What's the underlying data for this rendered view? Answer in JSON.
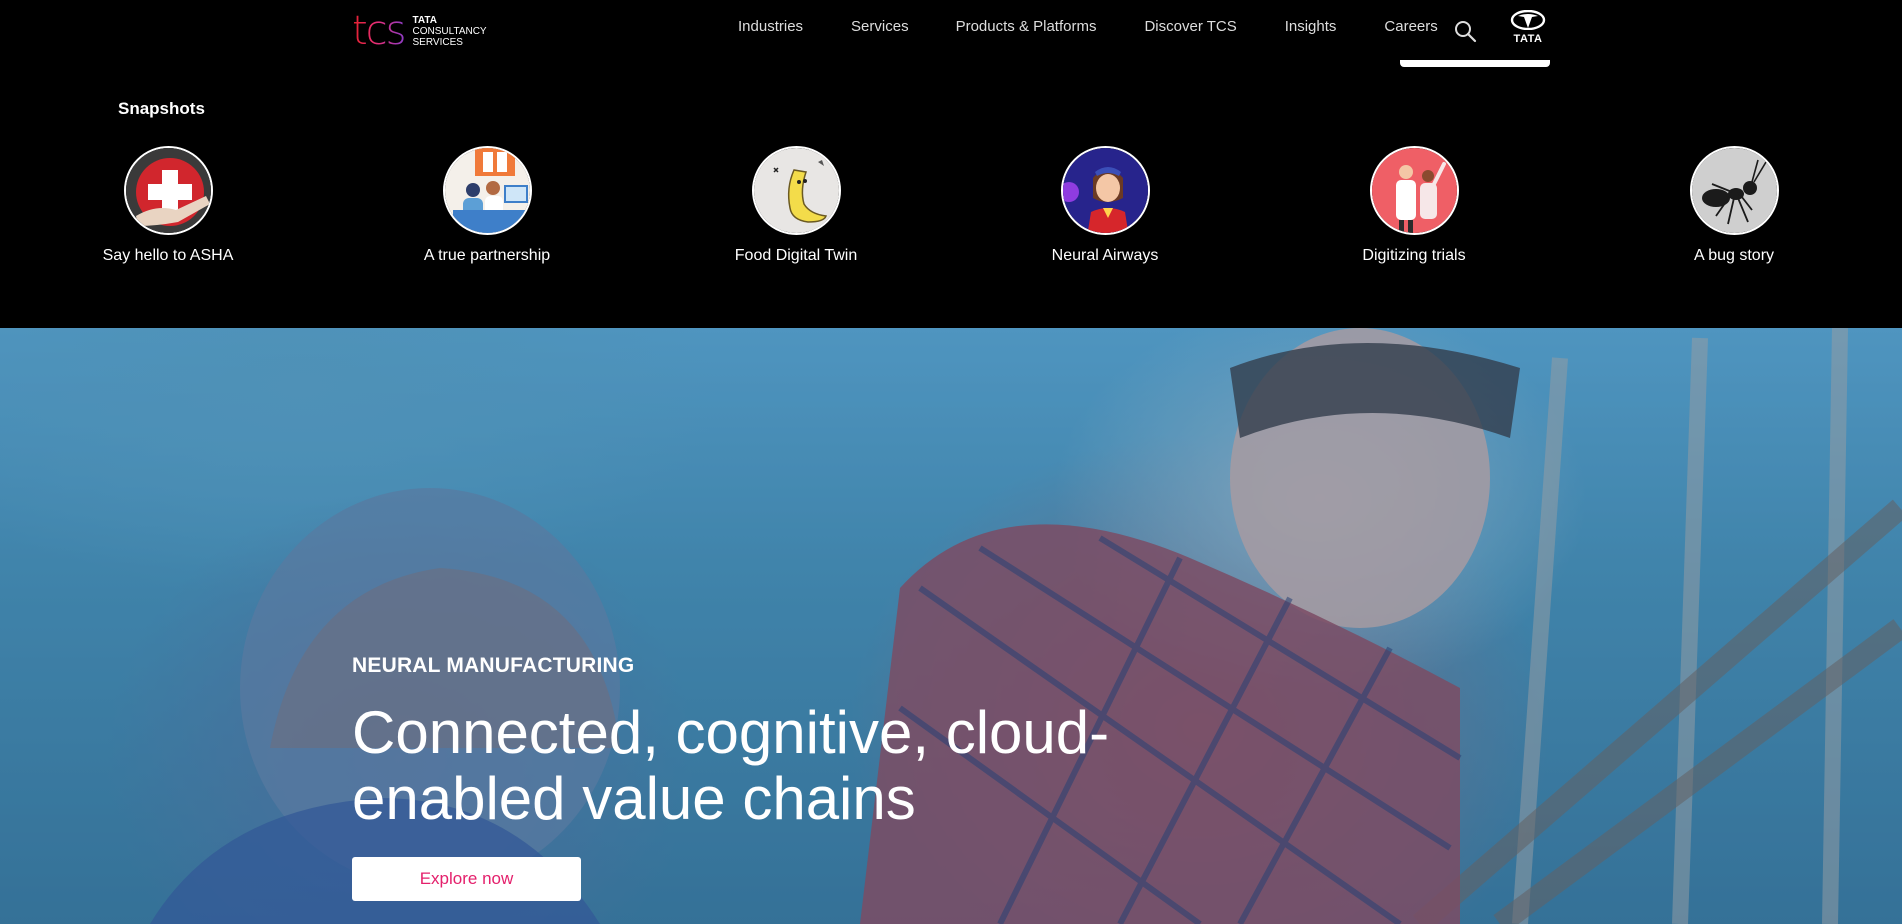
{
  "header": {
    "logo": {
      "mark": "tcs",
      "lines": [
        "TATA",
        "CONSULTANCY",
        "SERVICES"
      ]
    },
    "nav": [
      "Industries",
      "Services",
      "Products & Platforms",
      "Discover TCS",
      "Insights",
      "Careers"
    ],
    "search_icon": "search-icon",
    "brand_badge": "TATA"
  },
  "snapshots": {
    "title": "Snapshots",
    "items": [
      {
        "label": "Say hello to ASHA"
      },
      {
        "label": "A true partnership"
      },
      {
        "label": "Food Digital Twin"
      },
      {
        "label": "Neural Airways"
      },
      {
        "label": "Digitizing trials"
      },
      {
        "label": "A bug story"
      }
    ]
  },
  "hero": {
    "kicker": "NEURAL MANUFACTURING",
    "headline": "Connected, cognitive, cloud-enabled value chains",
    "cta": "Explore now"
  },
  "colors": {
    "accent": "#e4206c",
    "background": "#000000"
  }
}
